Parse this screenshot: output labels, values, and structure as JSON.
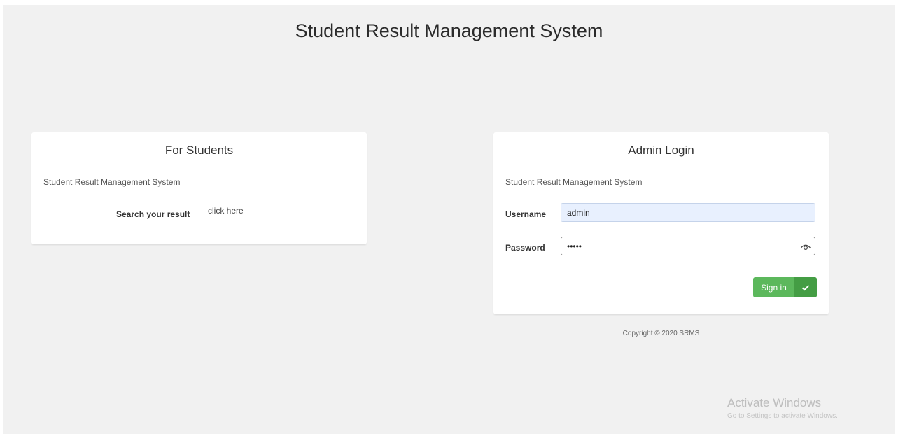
{
  "header": {
    "title": "Student Result Management System"
  },
  "students_card": {
    "title": "For Students",
    "subtitle": "Student Result Management System",
    "search_label": "Search your result",
    "link_text": "click here"
  },
  "admin_card": {
    "title": "Admin Login",
    "subtitle": "Student Result Management System",
    "username_label": "Username",
    "username_value": "admin",
    "password_label": "Password",
    "password_value": "•••••",
    "eye_icon": "eye-icon",
    "signin_label": "Sign in",
    "signin_icon": "check-icon"
  },
  "footer": {
    "copyright": "Copyright © 2020 SRMS"
  },
  "watermark": {
    "title": "Activate Windows",
    "subtitle": "Go to Settings to activate Windows."
  },
  "colors": {
    "page_background": "#f1f1f1",
    "card_background": "#ffffff",
    "signin_green": "#5cb85c",
    "signin_icon_green": "#449d44",
    "autofill_blue": "#e8f0fe"
  }
}
